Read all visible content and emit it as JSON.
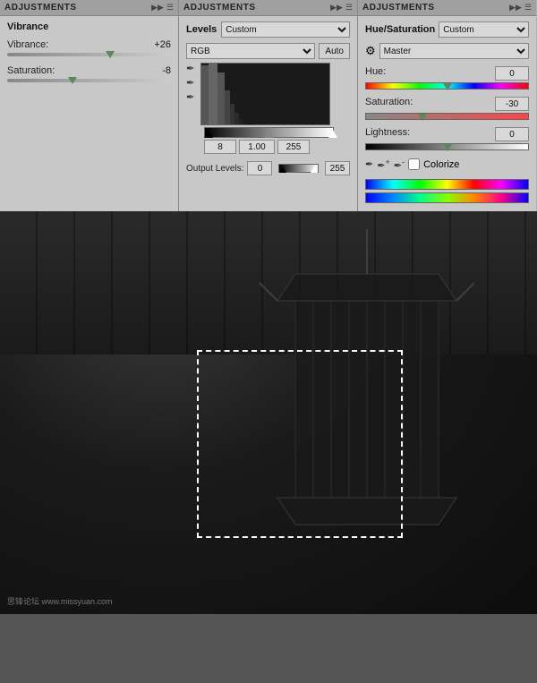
{
  "panel1": {
    "title": "ADJUSTMENTS",
    "section": "Vibrance",
    "vibrance_label": "Vibrance:",
    "vibrance_value": "+26",
    "vibrance_pct": 63,
    "saturation_label": "Saturation:",
    "saturation_value": "-8",
    "saturation_pct": 40
  },
  "panel2": {
    "title": "ADJUSTMENTS",
    "section": "Levels",
    "preset_label": "Custom",
    "channel_label": "RGB",
    "auto_label": "Auto",
    "input_black": "8",
    "input_mid": "1.00",
    "input_white": "255",
    "output_label": "Output Levels:",
    "output_black": "0",
    "output_white": "255"
  },
  "panel3": {
    "title": "ADJUSTMENTS",
    "section": "Hue/Saturation",
    "preset_label": "Custom",
    "master_label": "Master",
    "hue_label": "Hue:",
    "hue_value": "0",
    "hue_pct": 50,
    "sat_label": "Saturation:",
    "sat_value": "-30",
    "sat_pct": 35,
    "light_label": "Lightness:",
    "light_value": "0",
    "light_pct": 50,
    "colorize_label": "Colorize"
  },
  "image": {
    "watermark": "思锋论坛  www.missyuan.com"
  }
}
